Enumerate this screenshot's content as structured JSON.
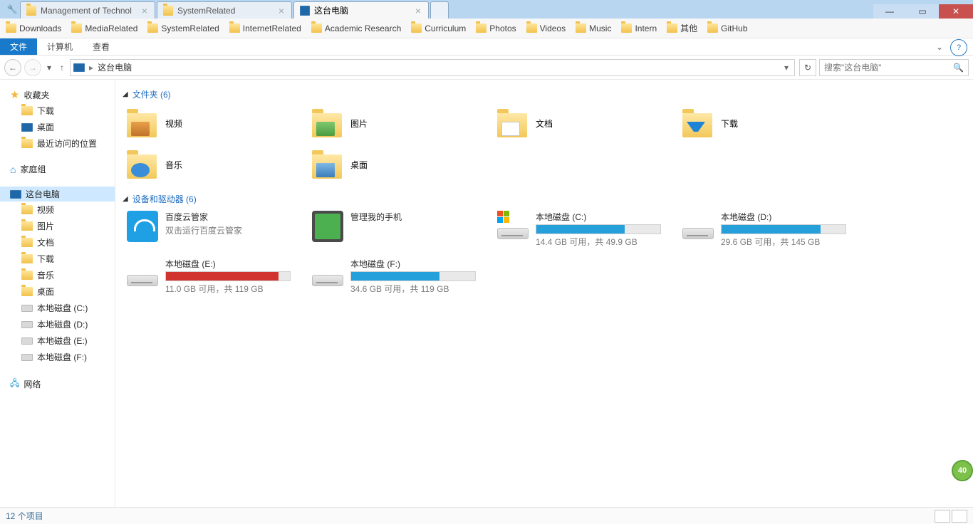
{
  "tabs": [
    {
      "label": "Management of Technol"
    },
    {
      "label": "SystemRelated"
    },
    {
      "label": "这台电脑"
    }
  ],
  "active_tab_index": 2,
  "bookmarks": [
    "Downloads",
    "MediaRelated",
    "SystemRelated",
    "InternetRelated",
    "Academic Research",
    "Curriculum",
    "Photos",
    "Videos",
    "Music",
    "Intern",
    "其他",
    "GitHub"
  ],
  "menu": {
    "file": "文件",
    "computer": "计算机",
    "view": "查看"
  },
  "help_icon": "?",
  "address": {
    "root_icon": "computer-icon",
    "crumb": "这台电脑",
    "dropdown": "▾"
  },
  "search": {
    "placeholder": "搜索\"这台电脑\""
  },
  "sidebar": {
    "favorites": {
      "label": "收藏夹",
      "items": [
        "下载",
        "桌面",
        "最近访问的位置"
      ]
    },
    "homegroup": {
      "label": "家庭组"
    },
    "thispc": {
      "label": "这台电脑",
      "items": [
        "视频",
        "图片",
        "文档",
        "下载",
        "音乐",
        "桌面",
        "本地磁盘 (C:)",
        "本地磁盘 (D:)",
        "本地磁盘 (E:)",
        "本地磁盘 (F:)"
      ]
    },
    "network": {
      "label": "网络"
    }
  },
  "sections": {
    "folders": {
      "title": "文件夹 (6)",
      "items": [
        "视频",
        "图片",
        "文档",
        "下载",
        "音乐",
        "桌面"
      ]
    },
    "devices": {
      "title": "设备和驱动器 (6)",
      "apps": [
        {
          "name": "百度云管家",
          "sub": "双击运行百度云管家"
        },
        {
          "name": "管理我的手机",
          "sub": ""
        }
      ],
      "drives": [
        {
          "name": "本地磁盘 (C:)",
          "free": "14.4 GB 可用，共 49.9 GB",
          "pct": 71,
          "color": "blue",
          "system": true
        },
        {
          "name": "本地磁盘 (D:)",
          "free": "29.6 GB 可用，共 145 GB",
          "pct": 80,
          "color": "blue",
          "system": false
        },
        {
          "name": "本地磁盘 (E:)",
          "free": "11.0 GB 可用，共 119 GB",
          "pct": 91,
          "color": "red",
          "system": false
        },
        {
          "name": "本地磁盘 (F:)",
          "free": "34.6 GB 可用，共 119 GB",
          "pct": 71,
          "color": "blue",
          "system": false
        }
      ]
    }
  },
  "status": {
    "text": "12 个项目"
  },
  "badge": "40"
}
